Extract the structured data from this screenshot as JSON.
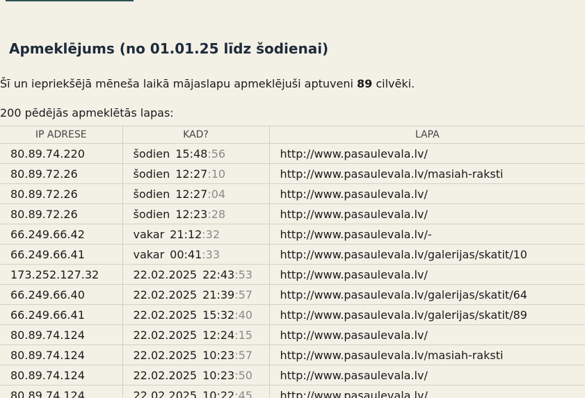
{
  "heading": "Apmeklējums (no 01.01.25 līdz šodienai)",
  "summary": {
    "before": "Šī un iepriekšējā mēneša laikā mājaslapu apmeklējuši aptuveni ",
    "count": "89",
    "after": " cilvēki."
  },
  "list_title": "200 pēdējās apmeklētās lapas:",
  "table": {
    "headers": [
      "IP ADRESE",
      "KAD?",
      "LAPA"
    ],
    "rows": [
      {
        "ip": "80.89.74.220",
        "date": "šodien",
        "time": "15:48",
        "sec": ":56",
        "page": "http://www.pasaulevala.lv/"
      },
      {
        "ip": "80.89.72.26",
        "date": "šodien",
        "time": "12:27",
        "sec": ":10",
        "page": "http://www.pasaulevala.lv/masiah-raksti"
      },
      {
        "ip": "80.89.72.26",
        "date": "šodien",
        "time": "12:27",
        "sec": ":04",
        "page": "http://www.pasaulevala.lv/"
      },
      {
        "ip": "80.89.72.26",
        "date": "šodien",
        "time": "12:23",
        "sec": ":28",
        "page": "http://www.pasaulevala.lv/"
      },
      {
        "ip": "66.249.66.42",
        "date": "vakar",
        "time": "21:12",
        "sec": ":32",
        "page": "http://www.pasaulevala.lv/-"
      },
      {
        "ip": "66.249.66.41",
        "date": "vakar",
        "time": "00:41",
        "sec": ":33",
        "page": "http://www.pasaulevala.lv/galerijas/skatit/10"
      },
      {
        "ip": "173.252.127.32",
        "date": "22.02.2025",
        "time": "22:43",
        "sec": ":53",
        "page": "http://www.pasaulevala.lv/"
      },
      {
        "ip": "66.249.66.40",
        "date": "22.02.2025",
        "time": "21:39",
        "sec": ":57",
        "page": "http://www.pasaulevala.lv/galerijas/skatit/64"
      },
      {
        "ip": "66.249.66.41",
        "date": "22.02.2025",
        "time": "15:32",
        "sec": ":40",
        "page": "http://www.pasaulevala.lv/galerijas/skatit/89"
      },
      {
        "ip": "80.89.74.124",
        "date": "22.02.2025",
        "time": "12:24",
        "sec": ":15",
        "page": "http://www.pasaulevala.lv/"
      },
      {
        "ip": "80.89.74.124",
        "date": "22.02.2025",
        "time": "10:23",
        "sec": ":57",
        "page": "http://www.pasaulevala.lv/masiah-raksti"
      },
      {
        "ip": "80.89.74.124",
        "date": "22.02.2025",
        "time": "10:23",
        "sec": ":50",
        "page": "http://www.pasaulevala.lv/"
      },
      {
        "ip": "80.89.74.124",
        "date": "22.02.2025",
        "time": "10:22",
        "sec": ":45",
        "page": "http://www.pasaulevala.lv/"
      }
    ]
  },
  "colors": {
    "background": "#f3f0e6",
    "heading": "#1d2b3a",
    "seconds": "#8a8a8a",
    "border": "#d4d0c4"
  }
}
